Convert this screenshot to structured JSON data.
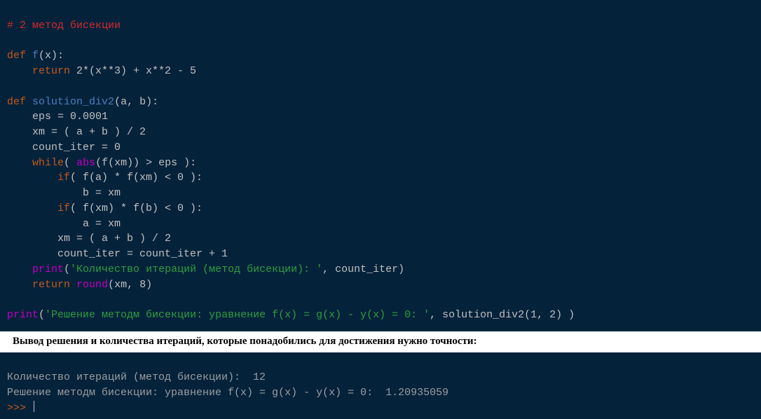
{
  "code": {
    "c1_comment": "# 2 метод бисекции",
    "l1_def": "def",
    "l1_fn": "f",
    "l1_rest": "(x):",
    "l2a": "    ",
    "l2_kw": "return",
    "l2b": " 2*(x**3) + x**2 - 5",
    "l3_def": "def",
    "l3_fn": "solution_div2",
    "l3_rest": "(a, b):",
    "l4": "    eps = 0.0001",
    "l5": "    xm = ( a + b ) / 2",
    "l6": "    count_iter = 0",
    "l7a": "    ",
    "l7_kw": "while",
    "l7b": "( ",
    "l7_builtin": "abs",
    "l7c": "(f(xm)) > eps ):",
    "l8a": "        ",
    "l8_kw": "if",
    "l8b": "( f(a) * f(xm) < 0 ):",
    "l9": "            b = xm",
    "l10a": "        ",
    "l10_kw": "if",
    "l10b": "( f(xm) * f(b) < 0 ):",
    "l11": "            a = xm",
    "l12": "        xm = ( a + b ) / 2",
    "l13": "        count_iter = count_iter + 1",
    "l14a": "    ",
    "l14_builtin": "print",
    "l14b": "(",
    "l14_str": "'Количество итераций (метод бисекции): '",
    "l14c": ", count_iter)",
    "l15a": "    ",
    "l15_kw": "return",
    "l15b": " ",
    "l15_builtin": "round",
    "l15c": "(xm, 8)",
    "l16_builtin": "print",
    "l16b": "(",
    "l16_str": "'Решение методм бисекции: уравнение f(x) = g(x) - y(x) = 0: '",
    "l16c": ", solution_div2(1, 2) )"
  },
  "caption": "Вывод решения и количества итераций, которые понадобились для достижения нужно точности:",
  "output": {
    "line1": "Количество итераций (метод бисекции):  12",
    "line2": "Решение методм бисекции: уравнение f(x) = g(x) - y(x) = 0:  1.20935059",
    "prompt": ">>> "
  }
}
